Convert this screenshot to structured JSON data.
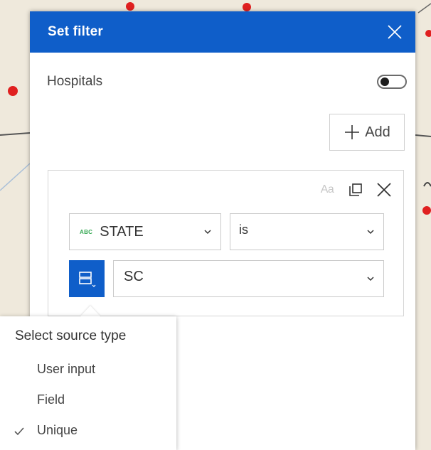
{
  "dialog": {
    "title": "Set filter",
    "layer_name": "Hospitals",
    "add_label": "Add"
  },
  "filter_clause": {
    "case_icon_text": "Aa",
    "field": {
      "type_badge": "ABC",
      "value": "STATE"
    },
    "operator": {
      "value": "is"
    },
    "value": {
      "value": "SC"
    }
  },
  "source_popup": {
    "title": "Select source type",
    "options": [
      {
        "label": "User input",
        "selected": false
      },
      {
        "label": "Field",
        "selected": false
      },
      {
        "label": "Unique",
        "selected": true
      }
    ]
  },
  "colors": {
    "header_bg": "#0f5ec9",
    "map_bg": "#efe9dc",
    "map_point": "#e02020",
    "field_type_badge": "#35a853"
  },
  "icons": {
    "close": "close-icon",
    "toggle": "toggle-switch",
    "add": "plus-icon",
    "case_sensitive": "case-sensitive-icon",
    "duplicate": "duplicate-icon",
    "remove": "close-icon",
    "dropdown": "chevron-down-icon",
    "source_type": "source-type-icon",
    "checked": "check-icon"
  }
}
